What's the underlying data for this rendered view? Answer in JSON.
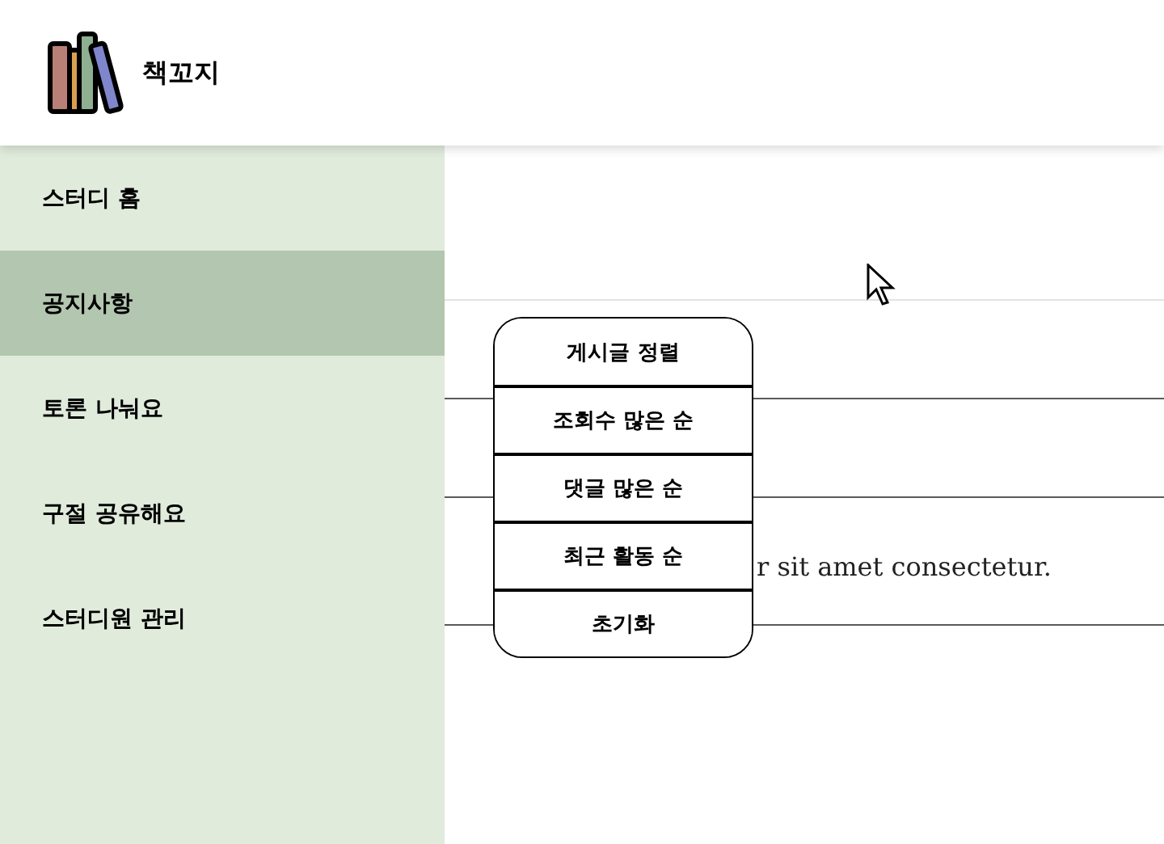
{
  "header": {
    "logo_text": "책꼬지"
  },
  "sidebar": {
    "items": [
      {
        "label": "스터디 홈",
        "selected": false
      },
      {
        "label": "공지사항",
        "selected": true
      },
      {
        "label": "토론 나눠요",
        "selected": false
      },
      {
        "label": "구절 공유해요",
        "selected": false
      },
      {
        "label": "스터디원 관리",
        "selected": false
      }
    ]
  },
  "main": {
    "post_text": "r sit amet consectetur."
  },
  "sort_menu": {
    "items": [
      "게시글 정렬",
      "조회수 많은 순",
      "댓글 많은 순",
      "최근 활동 순",
      "초기화"
    ]
  }
}
